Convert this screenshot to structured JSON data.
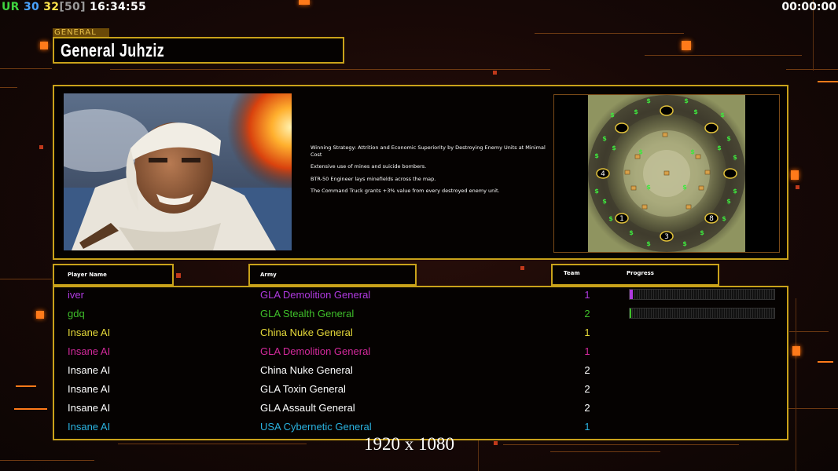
{
  "hud": {
    "faction_tag": "UR",
    "fps_current": "30",
    "fps_target": "32",
    "fps_bracket": "[50]",
    "clock": "16:34:55",
    "game_timer": "00:00:00"
  },
  "general": {
    "label": "GENERAL",
    "name": "General Juhziz"
  },
  "strategy": [
    "Winning Strategy: Attrition and Economic Superiority by Destroying Enemy Units at Minimal Cost",
    "Extensive use of mines and suicide bombers.",
    "BTR-50 Engineer lays minefields across the map.",
    "The Command Truck grants +3% value from every destroyed enemy unit."
  ],
  "minimap": {
    "start_positions": [
      "4",
      "1",
      "3",
      "8"
    ],
    "money_symbol": "$"
  },
  "columns": {
    "player": "Player Name",
    "army": "Army",
    "team": "Team",
    "progress": "Progress"
  },
  "players": [
    {
      "name": "iver",
      "army": "GLA Demolition General",
      "team": "1",
      "color": "#b03ae0",
      "progress": 0.02
    },
    {
      "name": "gdq",
      "army": "GLA Stealth General",
      "team": "2",
      "color": "#3fbf2a",
      "progress": 0.01
    },
    {
      "name": "Insane AI",
      "army": "China Nuke General",
      "team": "1",
      "color": "#e6da3a",
      "progress": null
    },
    {
      "name": "Insane AI",
      "army": "GLA Demolition General",
      "team": "1",
      "color": "#d42a9c",
      "progress": null
    },
    {
      "name": "Insane AI",
      "army": "China Nuke General",
      "team": "2",
      "color": "#ffffff",
      "progress": null
    },
    {
      "name": "Insane AI",
      "army": "GLA Toxin General",
      "team": "2",
      "color": "#ffffff",
      "progress": null
    },
    {
      "name": "Insane AI",
      "army": "GLA Assault General",
      "team": "2",
      "color": "#ffffff",
      "progress": null
    },
    {
      "name": "Insane AI",
      "army": "USA Cybernetic General",
      "team": "1",
      "color": "#2ab3e0",
      "progress": null
    }
  ],
  "footer": {
    "resolution": "1920 x 1080"
  },
  "colors": {
    "frame_gold": "#c9a21a",
    "hud_green": "#3fd43f",
    "hud_blue": "#4aa3ff",
    "hud_yellow": "#ffe14a",
    "hud_grey": "#9a9a9a"
  }
}
